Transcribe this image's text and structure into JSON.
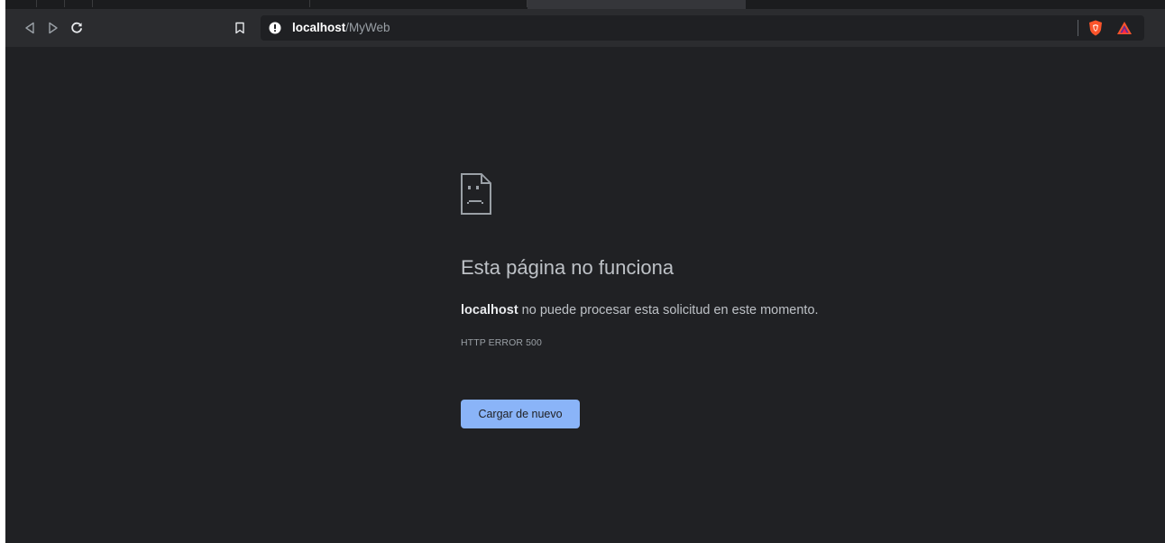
{
  "toolbar": {
    "back_icon": "back-icon",
    "forward_icon": "forward-icon",
    "reload_icon": "reload-icon",
    "bookmark_icon": "bookmark-icon"
  },
  "omnibox": {
    "security_icon": "info-icon",
    "host": "localhost",
    "path": "/MyWeb",
    "extensions": [
      "brave-shield-icon",
      "brave-rewards-icon"
    ]
  },
  "error_page": {
    "icon": "sad-page-icon",
    "title": "Esta página no funciona",
    "description_host": "localhost",
    "description_rest": " no puede procesar esta solicitud en este momento.",
    "error_code": "HTTP ERROR 500",
    "reload_button_label": "Cargar de nuevo"
  },
  "colors": {
    "page_background": "#202124",
    "toolbar_background": "#2b2c2f",
    "omnibox_background": "#1f2023",
    "accent": "#8ab4f8",
    "brave_orange": "#fb542b"
  }
}
